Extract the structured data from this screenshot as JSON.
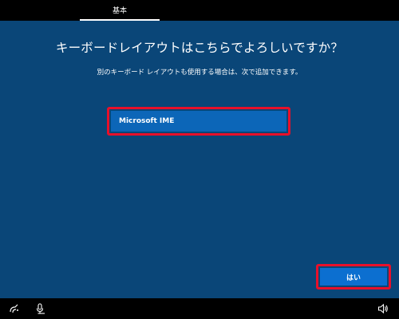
{
  "header": {
    "tab_label": "基本"
  },
  "main": {
    "title": "キーボードレイアウトはこちらでよろしいですか？",
    "subtitle": "別のキーボード レイアウトも使用する場合は、次で追加できます。",
    "layouts": [
      {
        "label": "Microsoft IME",
        "selected": true
      }
    ]
  },
  "footer": {
    "yes_label": "はい",
    "icons": [
      "ease-of-access-icon",
      "microphone-icon",
      "volume-icon"
    ]
  },
  "colors": {
    "background": "#0a4678",
    "selected_item": "#0c66b8",
    "button": "#0c6fd0",
    "highlight_border": "#e8102a",
    "bars": "#000000"
  }
}
